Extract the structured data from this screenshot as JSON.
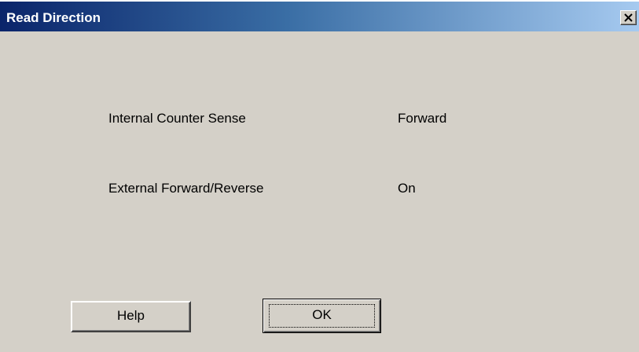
{
  "window": {
    "title": "Read Direction",
    "close_icon": "close-x-icon"
  },
  "settings": [
    {
      "label": "Internal Counter Sense",
      "value": "Forward"
    },
    {
      "label": "External Forward/Reverse",
      "value": "On"
    }
  ],
  "buttons": {
    "help_label": "Help",
    "ok_label": "OK"
  },
  "colors": {
    "titlebar_start": "#0a246a",
    "titlebar_end": "#a6caf0",
    "dialog_background": "#d4d0c8"
  }
}
